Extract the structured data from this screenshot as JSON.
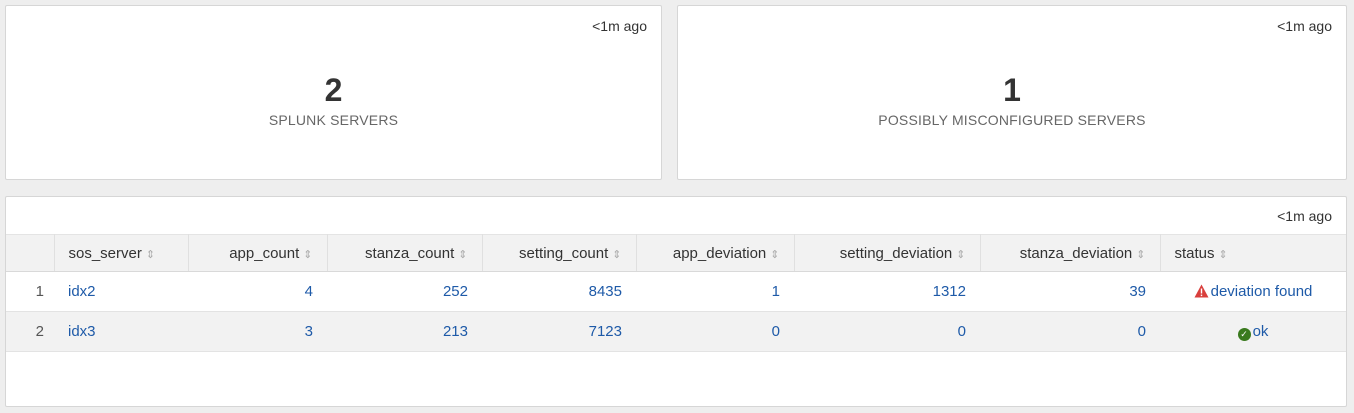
{
  "panels": {
    "left": {
      "refresh": "<1m ago",
      "value": "2",
      "label": "SPLUNK SERVERS"
    },
    "right": {
      "refresh": "<1m ago",
      "value": "1",
      "label": "POSSIBLY MISCONFIGURED SERVERS"
    }
  },
  "table": {
    "refresh": "<1m ago",
    "columns": [
      "sos_server",
      "app_count",
      "stanza_count",
      "setting_count",
      "app_deviation",
      "setting_deviation",
      "stanza_deviation",
      "status"
    ],
    "rows": [
      {
        "num": "1",
        "sos_server": "idx2",
        "app_count": "4",
        "stanza_count": "252",
        "setting_count": "8435",
        "app_deviation": "1",
        "setting_deviation": "1312",
        "stanza_deviation": "39",
        "status": "deviation found",
        "status_icon": "warning-icon"
      },
      {
        "num": "2",
        "sos_server": "idx3",
        "app_count": "3",
        "stanza_count": "213",
        "setting_count": "7123",
        "app_deviation": "0",
        "setting_deviation": "0",
        "stanza_deviation": "0",
        "status": "ok",
        "status_icon": "check-circle-icon"
      }
    ],
    "sort_icon": "sort-icon"
  },
  "colors": {
    "link": "#1e5aa8",
    "warning": "#d93f3c",
    "ok": "#3a7a1e",
    "background": "#eeeeee"
  }
}
